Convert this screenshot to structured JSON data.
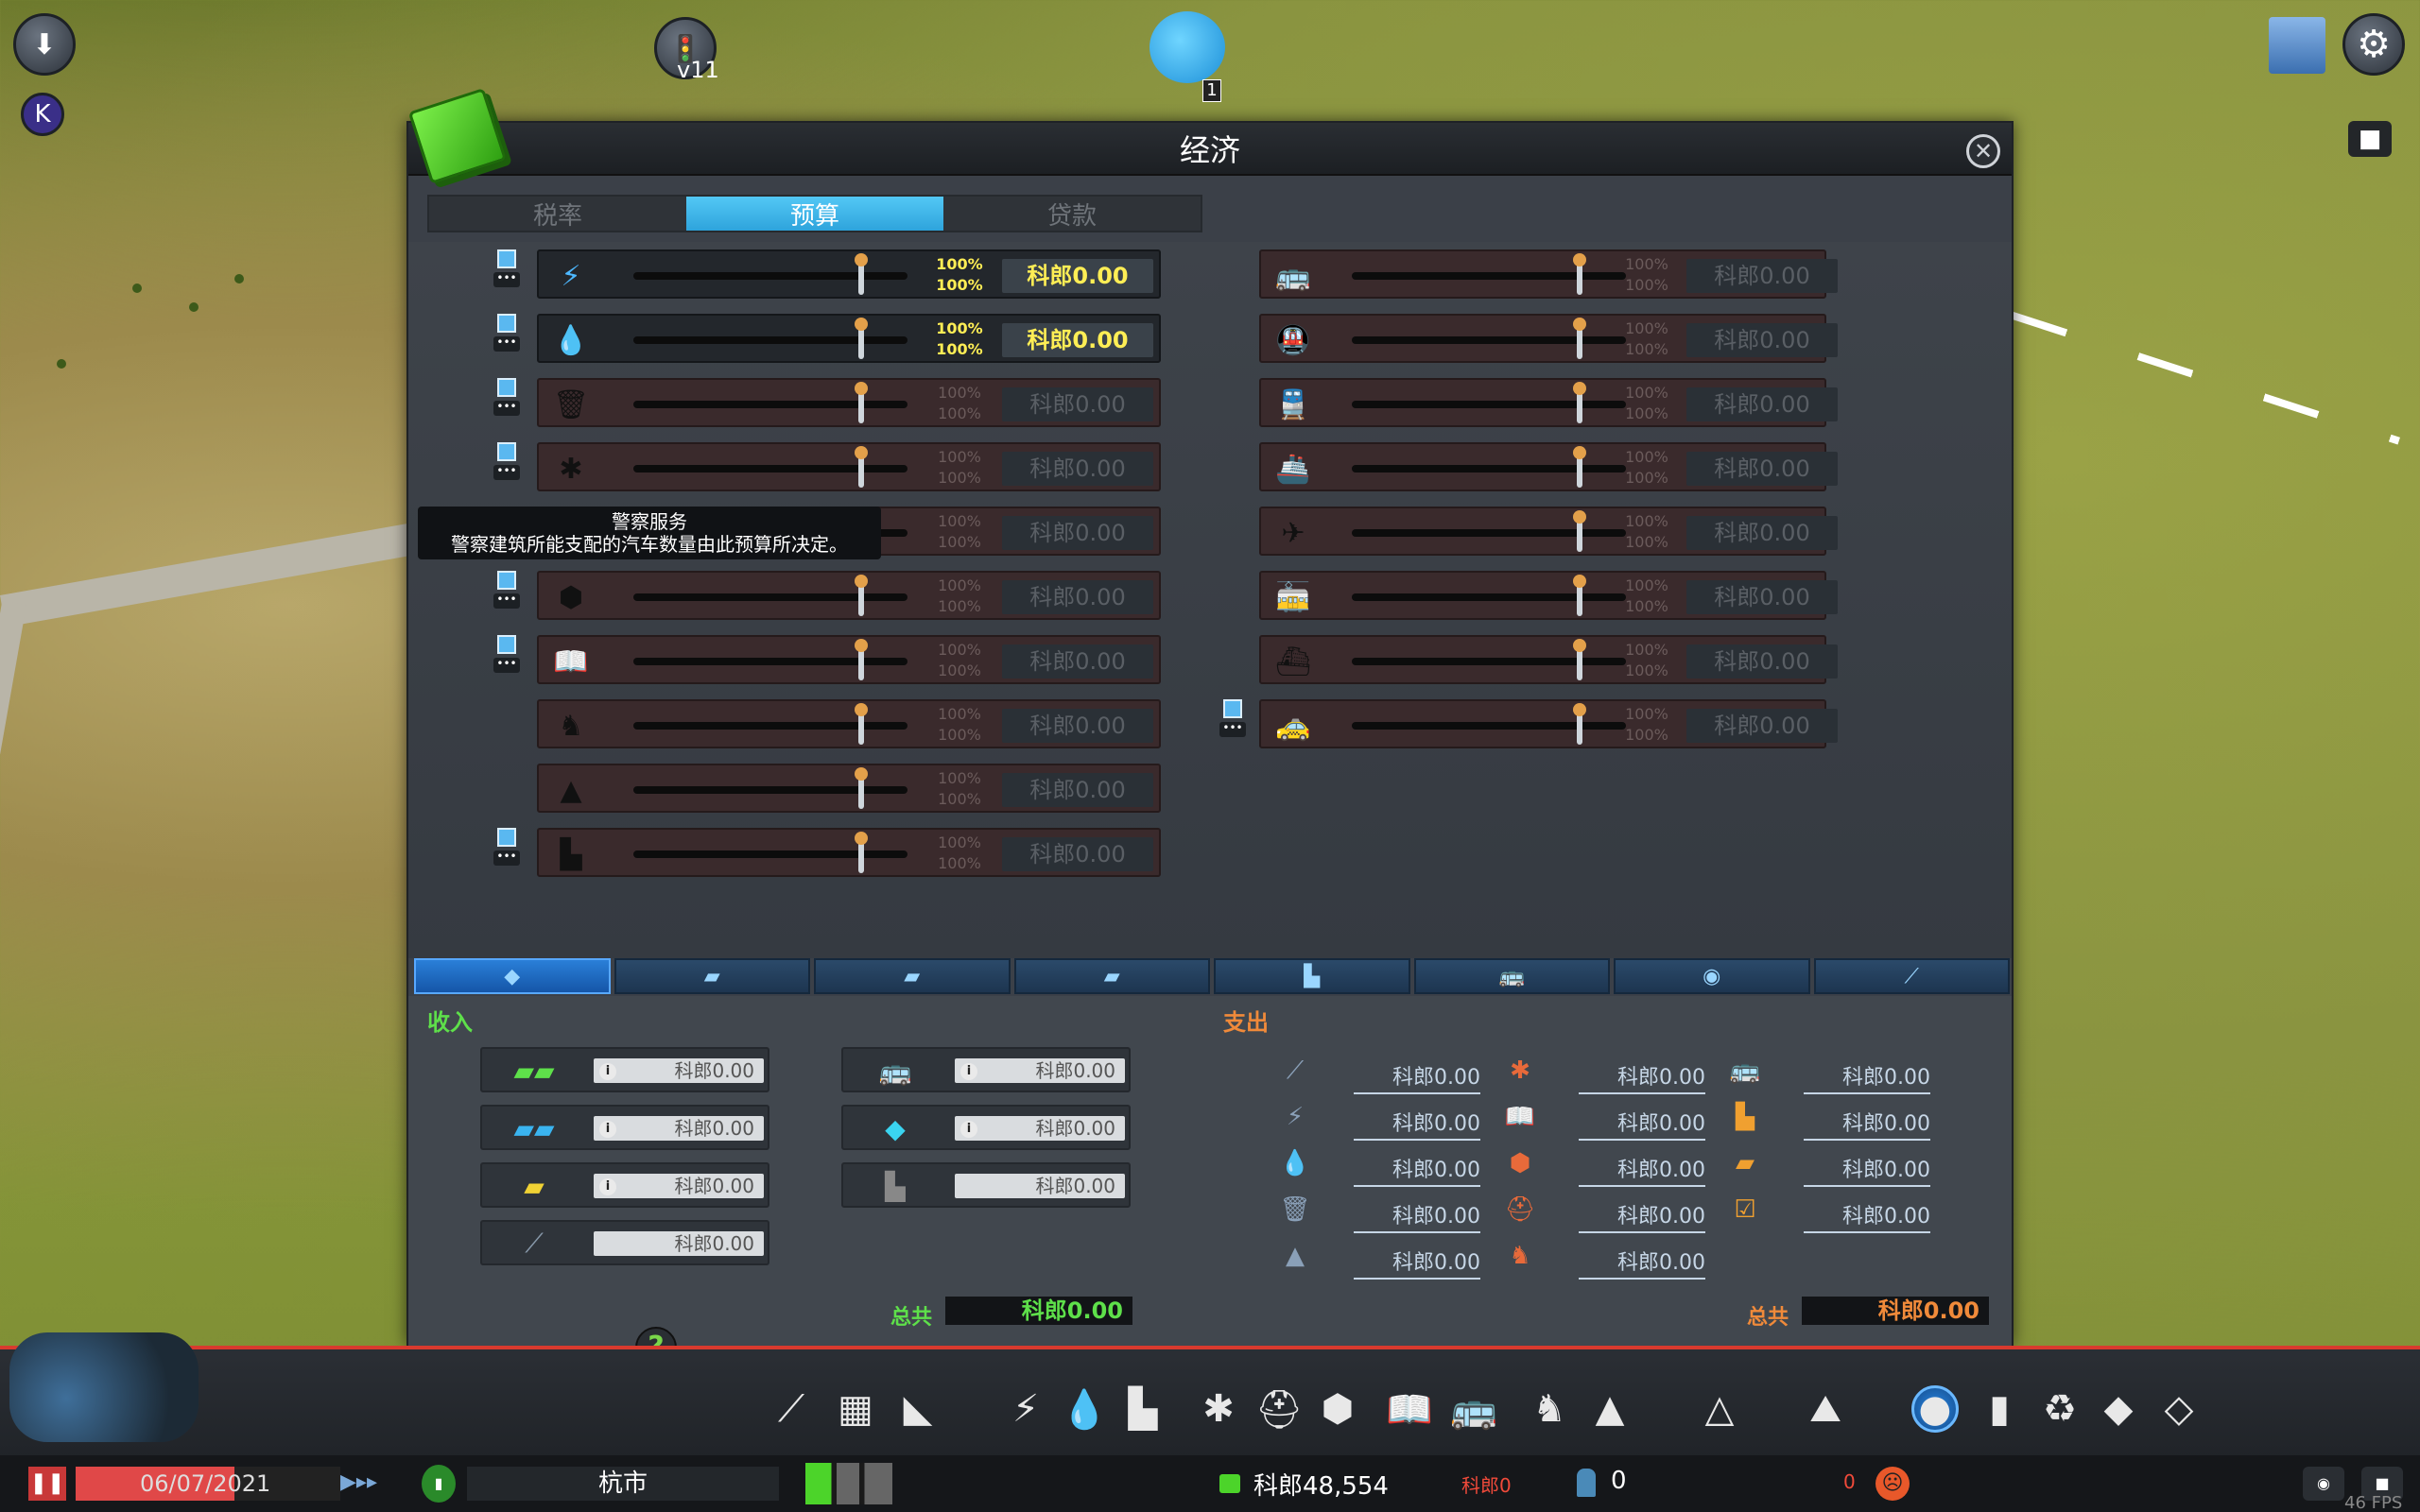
{
  "hud": {
    "traffic_label": "v11",
    "chirper_badge": "1",
    "k_label": "K"
  },
  "window": {
    "title": "经济",
    "close_glyph": "✕"
  },
  "tabs": [
    {
      "label": "税率"
    },
    {
      "label": "预算"
    },
    {
      "label": "贷款"
    }
  ],
  "budget_left": [
    {
      "icon": "electricity-icon",
      "glyph": "⚡",
      "pct_day": "100%",
      "pct_night": "100%",
      "value": "科郎0.00",
      "active": true,
      "toggle": true
    },
    {
      "icon": "water-icon",
      "glyph": "💧",
      "pct_day": "100%",
      "pct_night": "100%",
      "value": "科郎0.00",
      "active": true,
      "toggle": true
    },
    {
      "icon": "garbage-icon",
      "glyph": "🗑",
      "pct_day": "100%",
      "pct_night": "100%",
      "value": "科郎0.00",
      "active": false,
      "toggle": true
    },
    {
      "icon": "healthcare-icon",
      "glyph": "✱",
      "pct_day": "100%",
      "pct_night": "100%",
      "value": "科郎0.00",
      "active": false,
      "toggle": true
    },
    {
      "icon": "fire-icon",
      "glyph": "⛑",
      "pct_day": "100%",
      "pct_night": "100%",
      "value": "科郎0.00",
      "active": false,
      "toggle": false
    },
    {
      "icon": "police-icon",
      "glyph": "⬢",
      "pct_day": "100%",
      "pct_night": "100%",
      "value": "科郎0.00",
      "active": false,
      "toggle": true
    },
    {
      "icon": "education-icon",
      "glyph": "📖",
      "pct_day": "100%",
      "pct_night": "100%",
      "value": "科郎0.00",
      "active": false,
      "toggle": true
    },
    {
      "icon": "parks-icon",
      "glyph": "♞",
      "pct_day": "100%",
      "pct_night": "100%",
      "value": "科郎0.00",
      "active": false,
      "toggle": false
    },
    {
      "icon": "monument-icon",
      "glyph": "▲",
      "pct_day": "100%",
      "pct_night": "100%",
      "value": "科郎0.00",
      "active": false,
      "toggle": false
    },
    {
      "icon": "industry-icon",
      "glyph": "▙",
      "pct_day": "100%",
      "pct_night": "100%",
      "value": "科郎0.00",
      "active": false,
      "toggle": true
    }
  ],
  "budget_right": [
    {
      "icon": "bus-icon",
      "glyph": "🚌",
      "pct_day": "100%",
      "pct_night": "100%",
      "value": "科郎0.00",
      "toggle": false
    },
    {
      "icon": "metro-icon",
      "glyph": "🚇",
      "pct_day": "100%",
      "pct_night": "100%",
      "value": "科郎0.00",
      "toggle": false
    },
    {
      "icon": "train-icon",
      "glyph": "🚆",
      "pct_day": "100%",
      "pct_night": "100%",
      "value": "科郎0.00",
      "toggle": false
    },
    {
      "icon": "ship-icon",
      "glyph": "🚢",
      "pct_day": "100%",
      "pct_night": "100%",
      "value": "科郎0.00",
      "toggle": false
    },
    {
      "icon": "airplane-icon",
      "glyph": "✈",
      "pct_day": "100%",
      "pct_night": "100%",
      "value": "科郎0.00",
      "toggle": false
    },
    {
      "icon": "tram-icon",
      "glyph": "🚋",
      "pct_day": "100%",
      "pct_night": "100%",
      "value": "科郎0.00",
      "toggle": false
    },
    {
      "icon": "ferry-icon",
      "glyph": "⛴",
      "pct_day": "100%",
      "pct_night": "100%",
      "value": "科郎0.00",
      "toggle": false
    },
    {
      "icon": "taxi-icon",
      "glyph": "🚕",
      "pct_day": "100%",
      "pct_night": "100%",
      "value": "科郎0.00",
      "toggle": true
    }
  ],
  "tooltip": {
    "title": "警察服务",
    "text": "警察建筑所能支配的汽车数量由此预算所决定。"
  },
  "category_tabs": [
    {
      "icon": "overview-icon",
      "glyph": "◆"
    },
    {
      "icon": "residential-icon",
      "glyph": "▰"
    },
    {
      "icon": "commercial-icon",
      "glyph": "▰"
    },
    {
      "icon": "industrial-icon",
      "glyph": "▰"
    },
    {
      "icon": "office-icon",
      "glyph": "▙"
    },
    {
      "icon": "transport-icon",
      "glyph": "🚌"
    },
    {
      "icon": "tourism-icon",
      "glyph": "◉"
    },
    {
      "icon": "road-icon",
      "glyph": "⟋"
    }
  ],
  "income": {
    "title": "收入",
    "items_left": [
      {
        "icon": "residential-tax-icon",
        "glyph": "▰▰",
        "color": "#5ee04a",
        "value": "科郎0.00",
        "info": true
      },
      {
        "icon": "commercial-tax-icon",
        "glyph": "▰▰",
        "color": "#3ab4f0",
        "value": "科郎0.00",
        "info": true
      },
      {
        "icon": "industrial-tax-icon",
        "glyph": "▰",
        "color": "#f0d234",
        "value": "科郎0.00",
        "info": true
      },
      {
        "icon": "road-income-icon",
        "glyph": "⟋",
        "color": "#8899aa",
        "value": "科郎0.00",
        "info": false
      }
    ],
    "items_right": [
      {
        "icon": "transport-income-icon",
        "glyph": "🚌",
        "color": "#f0d234",
        "value": "科郎0.00",
        "info": true
      },
      {
        "icon": "office-tax-icon",
        "glyph": "◆",
        "color": "#3ad4f0",
        "value": "科郎0.00",
        "info": true
      },
      {
        "icon": "industry-income-icon",
        "glyph": "▙",
        "color": "#888888",
        "value": "科郎0.00",
        "info": false
      }
    ],
    "total_label": "总共",
    "total_value": "科郎0.00"
  },
  "expense": {
    "title": "支出",
    "columns": [
      [
        {
          "icon": "road-expense-icon",
          "glyph": "⟋",
          "value": "科郎0.00"
        },
        {
          "icon": "electricity-expense-icon",
          "glyph": "⚡",
          "value": "科郎0.00"
        },
        {
          "icon": "water-expense-icon",
          "glyph": "💧",
          "value": "科郎0.00"
        },
        {
          "icon": "garbage-expense-icon",
          "glyph": "🗑",
          "value": "科郎0.00"
        },
        {
          "icon": "monument-expense-icon",
          "glyph": "▲",
          "value": "科郎0.00"
        }
      ],
      [
        {
          "icon": "healthcare-expense-icon",
          "glyph": "✱",
          "value": "科郎0.00"
        },
        {
          "icon": "education-expense-icon",
          "glyph": "📖",
          "value": "科郎0.00"
        },
        {
          "icon": "police-expense-icon",
          "glyph": "⬢",
          "value": "科郎0.00"
        },
        {
          "icon": "fire-expense-icon",
          "glyph": "⛑",
          "value": "科郎0.00"
        },
        {
          "icon": "parks-expense-icon",
          "glyph": "♞",
          "value": "科郎0.00"
        }
      ],
      [
        {
          "icon": "transport-expense-icon",
          "glyph": "🚌",
          "value": "科郎0.00"
        },
        {
          "icon": "industry-expense-icon",
          "glyph": "▙",
          "value": "科郎0.00"
        },
        {
          "icon": "loan-expense-icon",
          "glyph": "▰",
          "value": "科郎0.00"
        },
        {
          "icon": "policy-expense-icon",
          "glyph": "☑",
          "value": "科郎0.00"
        }
      ]
    ],
    "total_label": "总共",
    "total_value": "科郎0.00"
  },
  "help_glyph": "?",
  "status": {
    "date": "06/07/2021",
    "city_name": "杭市",
    "money": "科郎48,554",
    "money_delta": "科郎0",
    "population": "0",
    "pop_delta": "0",
    "fps": "46 FPS"
  },
  "toolbar": [
    {
      "icon": "roads-tool-icon",
      "glyph": "⟋"
    },
    {
      "icon": "zoning-tool-icon",
      "glyph": "▦"
    },
    {
      "icon": "districts-tool-icon",
      "glyph": "◣"
    },
    {
      "icon": "electricity-tool-icon",
      "glyph": "⚡"
    },
    {
      "icon": "water-tool-icon",
      "glyph": "💧"
    },
    {
      "icon": "industry-tool-icon",
      "glyph": "▙"
    },
    {
      "icon": "healthcare-tool-icon",
      "glyph": "✱"
    },
    {
      "icon": "fire-tool-icon",
      "glyph": "⛑"
    },
    {
      "icon": "police-tool-icon",
      "glyph": "⬢"
    },
    {
      "icon": "education-tool-icon",
      "glyph": "📖"
    },
    {
      "icon": "transport-tool-icon",
      "glyph": "🚌"
    },
    {
      "icon": "parks-tool-icon",
      "glyph": "♞"
    },
    {
      "icon": "monuments-tool-icon",
      "glyph": "▲"
    },
    {
      "icon": "landscaping-tool-icon",
      "glyph": "△"
    },
    {
      "icon": "terraform-tool-icon",
      "glyph": "⛰"
    },
    {
      "icon": "economy-tool-icon",
      "glyph": "●"
    },
    {
      "icon": "policies-tool-icon",
      "glyph": "▮"
    },
    {
      "icon": "areas-tool-icon",
      "glyph": "♻"
    },
    {
      "icon": "info-views-tool-icon",
      "glyph": "◆"
    },
    {
      "icon": "bulldozer-tool-icon",
      "glyph": "◇"
    }
  ]
}
